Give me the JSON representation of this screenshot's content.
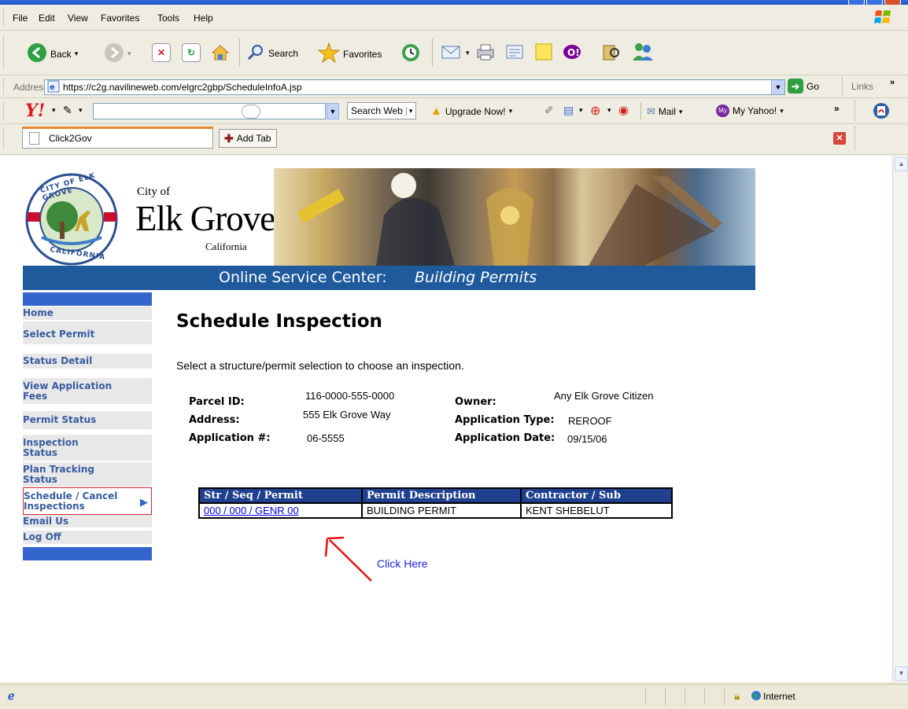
{
  "menu": [
    "File",
    "Edit",
    "View",
    "Favorites",
    "Tools",
    "Help"
  ],
  "toolbar": {
    "back": "Back",
    "search": "Search",
    "favorites": "Favorites"
  },
  "address": {
    "label": "Address",
    "url": "https://c2g.navilineweb.com/elgrc2gbp/ScheduleInfoA.jsp",
    "go": "Go",
    "links": "Links"
  },
  "yahoo_bar": {
    "logo": "Y!",
    "search_web": "Search Web",
    "upgrade": "Upgrade Now!",
    "mail": "Mail",
    "my_yahoo": "My Yahoo!",
    "more": "»"
  },
  "tabs": {
    "current": "Click2Gov",
    "add": "Add Tab"
  },
  "banner": {
    "city_of": "City of",
    "city": "Elk Grove",
    "state": "California",
    "seal_top": "CITY OF ELK GROVE",
    "seal_bottom": "CALIFORNIA",
    "service_center": "Online Service Center:",
    "section": "Building Permits"
  },
  "nav": [
    {
      "label": "Home",
      "active": false
    },
    {
      "label": "Select Permit",
      "active": false
    },
    {
      "label": "Status Detail",
      "active": false
    },
    {
      "label": "View Application Fees",
      "active": false
    },
    {
      "label": "Permit Status",
      "active": false
    },
    {
      "label": "Inspection Status",
      "active": false
    },
    {
      "label": "Plan Tracking Status",
      "active": false
    },
    {
      "label": "Schedule / Cancel Inspections",
      "active": true
    },
    {
      "label": "Email Us",
      "active": false
    },
    {
      "label": "Log Off",
      "active": false
    }
  ],
  "page": {
    "title": "Schedule Inspection",
    "instruction": "Select a structure/permit selection to choose an inspection."
  },
  "details": {
    "parcel_label": "Parcel ID:",
    "parcel_value": "116-0000-555-0000",
    "address_label": "Address:",
    "address_value": "555 Elk Grove Way",
    "app_num_label": "Application #:",
    "app_num_value": "06-5555",
    "owner_label": "Owner:",
    "owner_value": "Any Elk Grove Citizen",
    "app_type_label": "Application Type:",
    "app_type_value": "REROOF",
    "app_date_label": "Application Date:",
    "app_date_value": "09/15/06"
  },
  "table": {
    "headers": [
      "Str / Seq / Permit",
      "Permit Description",
      "Contractor / Sub"
    ],
    "rows": [
      {
        "permit": "000 / 000 / GENR 00",
        "description": "BUILDING PERMIT",
        "contractor": "KENT SHEBELUT"
      }
    ]
  },
  "annotation": {
    "click_here": "Click Here",
    "color": "#E8130F"
  },
  "status": {
    "zone": "Internet"
  },
  "colors": {
    "xp_blue": "#2E6BDB",
    "nav_blue": "#3366CC",
    "header_blue": "#1F3F8F",
    "banner_blue": "#1E5A9C",
    "link": "#0000EE"
  }
}
